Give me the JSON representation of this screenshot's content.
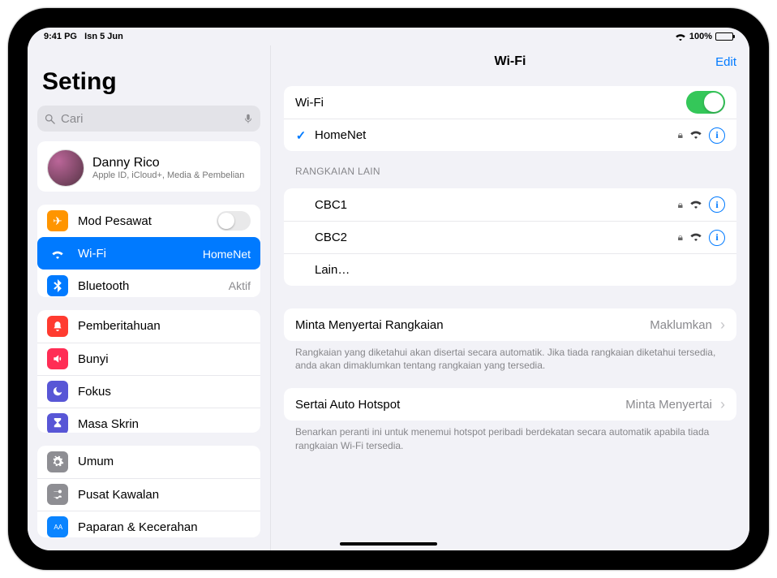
{
  "statusbar": {
    "time": "9:41 PG",
    "date": "Isn 5 Jun",
    "battery_pct": "100%"
  },
  "sidebar": {
    "title": "Seting",
    "search_placeholder": "Cari",
    "profile": {
      "name": "Danny Rico",
      "subtitle": "Apple ID, iCloud+, Media & Pembelian"
    },
    "group_conn": {
      "airplane": {
        "label": "Mod Pesawat",
        "on": false
      },
      "wifi": {
        "label": "Wi-Fi",
        "detail": "HomeNet"
      },
      "bluetooth": {
        "label": "Bluetooth",
        "detail": "Aktif"
      }
    },
    "group_notif": {
      "notif": "Pemberitahuan",
      "sound": "Bunyi",
      "focus": "Fokus",
      "screentime": "Masa Skrin"
    },
    "group_general": {
      "general": "Umum",
      "control": "Pusat Kawalan",
      "display": "Paparan & Kecerahan"
    }
  },
  "content": {
    "title": "Wi-Fi",
    "edit": "Edit",
    "wifi_row_label": "Wi-Fi",
    "connected": "HomeNet",
    "other_header": "RANGKAIAN LAIN",
    "networks": [
      {
        "name": "CBC1",
        "locked": true
      },
      {
        "name": "CBC2",
        "locked": true
      }
    ],
    "other_label": "Lain…",
    "ask": {
      "label": "Minta Menyertai Rangkaian",
      "value": "Maklumkan",
      "footnote": "Rangkaian yang diketahui akan disertai secara automatik. Jika tiada rangkaian diketahui tersedia, anda akan dimaklumkan tentang rangkaian yang tersedia."
    },
    "hotspot": {
      "label": "Sertai Auto Hotspot",
      "value": "Minta Menyertai",
      "footnote": "Benarkan peranti ini untuk menemui hotspot peribadi berdekatan secara automatik apabila tiada rangkaian Wi-Fi tersedia."
    }
  }
}
